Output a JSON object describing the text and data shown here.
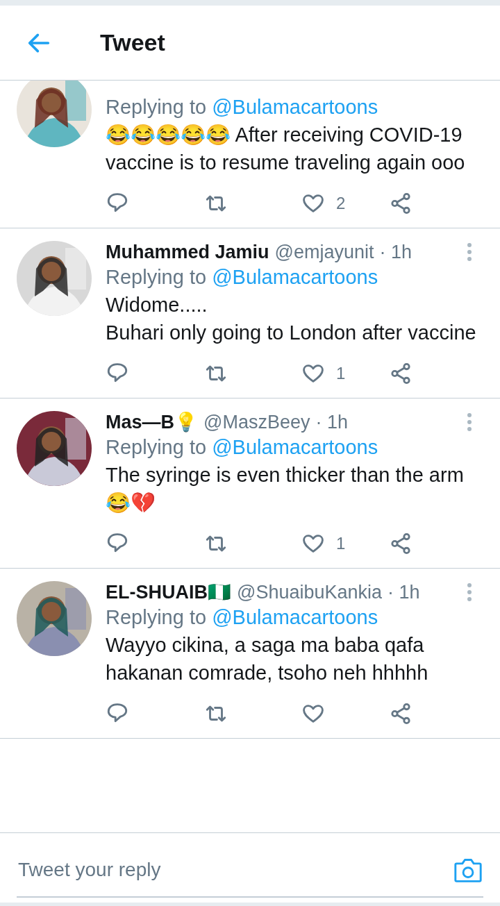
{
  "header": {
    "title": "Tweet"
  },
  "tweets": [
    {
      "avatar": {
        "kind": "picture"
      },
      "replying_label": "Replying to",
      "replying_to": "@Bulamacartoons",
      "body": [
        "😂😂😂😂😂 After receiving COVID-19 vaccine is to resume traveling again ooo"
      ],
      "likes": "2"
    },
    {
      "name": "Muhammed Jamiu",
      "handle": "@emjayunit",
      "time": "· 1h",
      "avatar": {
        "kind": "picture"
      },
      "replying_label": "Replying to",
      "replying_to": "@Bulamacartoons",
      "body": [
        "Widome.....",
        "Buhari only going to London after vaccine"
      ],
      "likes": "1"
    },
    {
      "name": "Mas—B💡",
      "handle": "@MaszBeey",
      "time": "· 1h",
      "avatar": {
        "kind": "picture"
      },
      "replying_label": "Replying to",
      "replying_to": "@Bulamacartoons",
      "body": [
        "The syringe is even thicker than the arm 😂💔"
      ],
      "likes": "1"
    },
    {
      "name": "EL-SHUAIB🇳🇬",
      "handle": "@ShuaibuKankia",
      "time": "· 1h",
      "avatar": {
        "kind": "picture"
      },
      "replying_label": "Replying to",
      "replying_to": "@Bulamacartoons",
      "body": [
        "Wayyo cikina, a saga ma baba qafa hakanan comrade, tsoho neh hhhhh"
      ]
    }
  ],
  "reply_bar": {
    "placeholder": "Tweet your reply"
  }
}
